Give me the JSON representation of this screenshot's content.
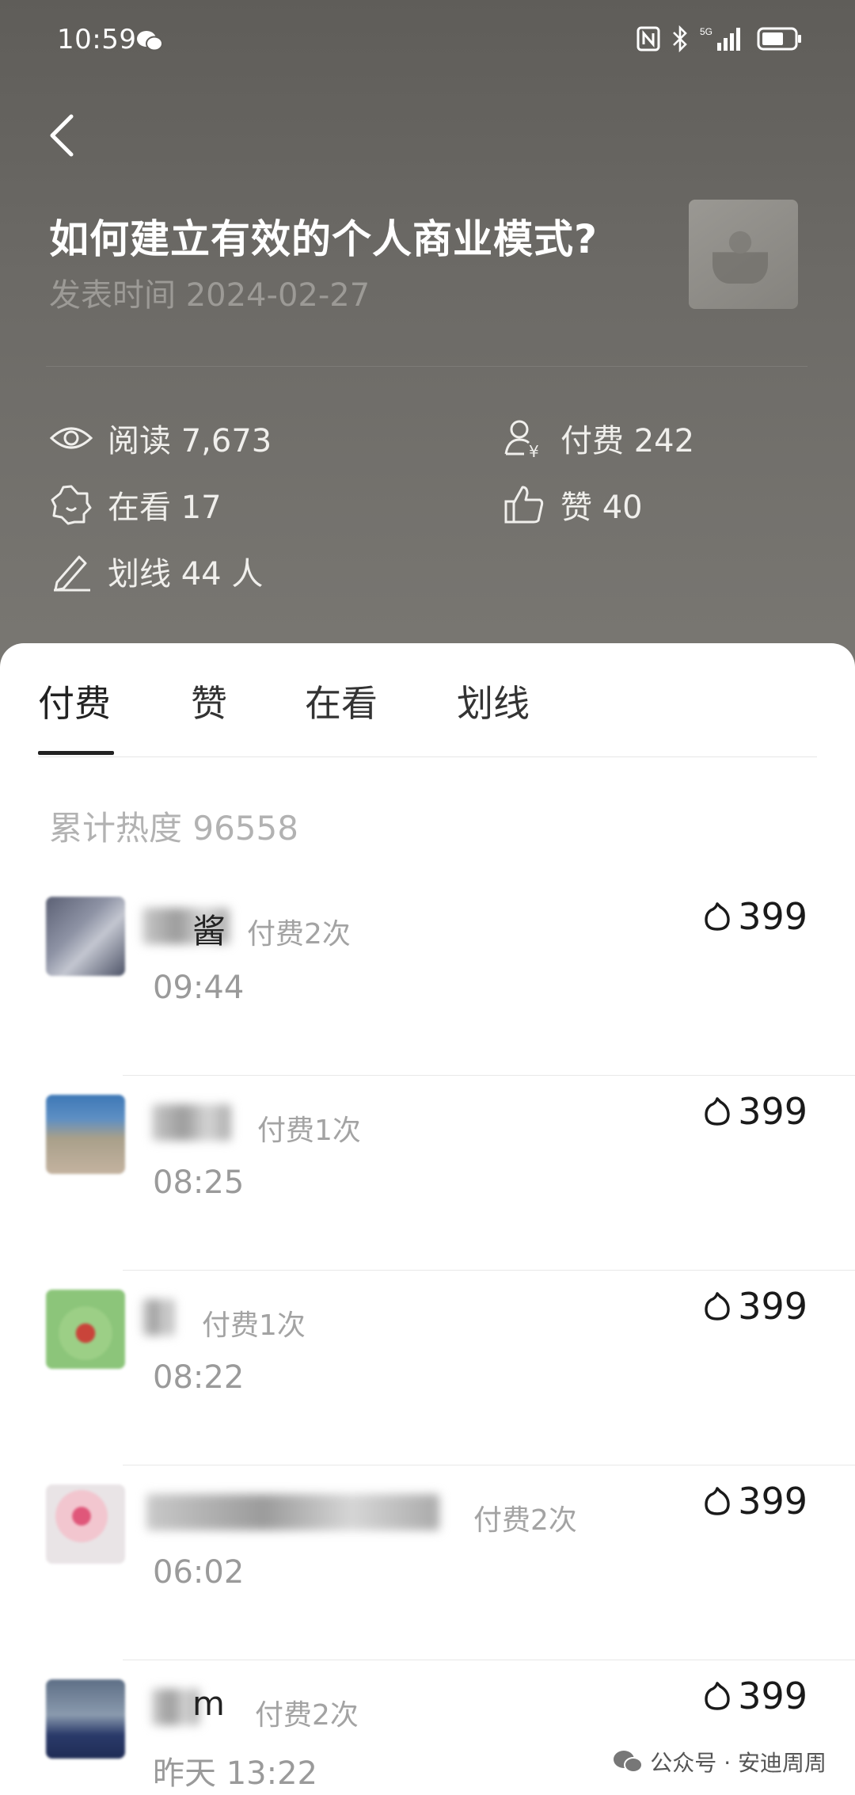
{
  "status_bar": {
    "time": "10:59",
    "network": "5G"
  },
  "article": {
    "title": "如何建立有效的个人商业模式?",
    "date": "发表时间 2024-02-27"
  },
  "stats": {
    "read": "阅读 7,673",
    "paid": "付费 242",
    "watching": "在看 17",
    "likes": "赞 40",
    "highlights": "划线 44 人"
  },
  "tabs": [
    {
      "label": "付费"
    },
    {
      "label": "赞"
    },
    {
      "label": "在看"
    },
    {
      "label": "划线"
    }
  ],
  "heat_total": "累计热度 96558",
  "rows": [
    {
      "name_visible": "酱",
      "paycount": "付费2次",
      "time": "09:44",
      "heat": "399"
    },
    {
      "name_visible": "",
      "paycount": "付费1次",
      "time": "08:25",
      "heat": "399"
    },
    {
      "name_visible": "",
      "paycount": "付费1次",
      "time": "08:22",
      "heat": "399"
    },
    {
      "name_visible": "",
      "paycount": "付费2次",
      "time": "06:02",
      "heat": "399"
    },
    {
      "name_visible": "m",
      "paycount": "付费2次",
      "time": "昨天 13:22",
      "heat": "399"
    }
  ],
  "watermark": "公众号 · 安迪周周"
}
